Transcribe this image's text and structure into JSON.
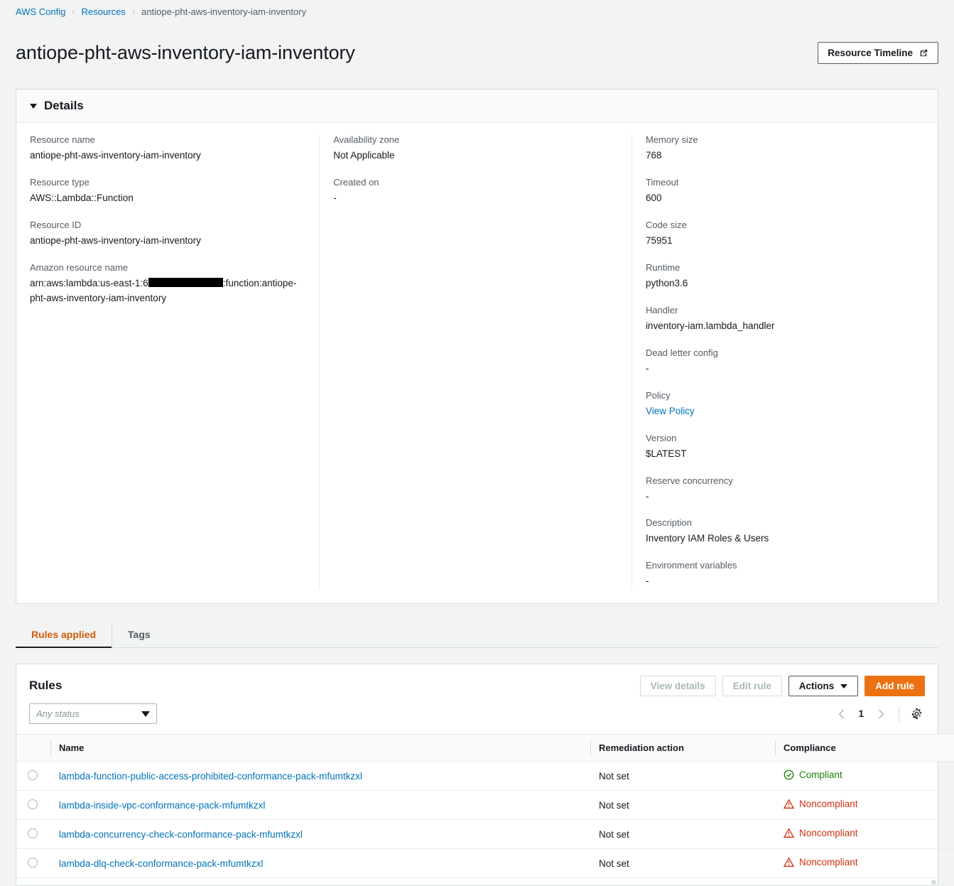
{
  "breadcrumb": {
    "items": [
      {
        "label": "AWS Config",
        "type": "link"
      },
      {
        "label": "Resources",
        "type": "link"
      },
      {
        "label": "antiope-pht-aws-inventory-iam-inventory",
        "type": "current"
      }
    ],
    "separator": "›"
  },
  "header": {
    "title": "antiope-pht-aws-inventory-iam-inventory",
    "timeline_button": "Resource Timeline"
  },
  "details": {
    "section_title": "Details",
    "column1": [
      {
        "label": "Resource name",
        "value": "antiope-pht-aws-inventory-iam-inventory"
      },
      {
        "label": "Resource type",
        "value": "AWS::Lambda::Function"
      },
      {
        "label": "Resource ID",
        "value": "antiope-pht-aws-inventory-iam-inventory"
      }
    ],
    "arn": {
      "label": "Amazon resource name",
      "prefix": "arn:aws:lambda:us-east-1:6",
      "redacted": "███████████",
      "suffix": ":function:antiope-pht-aws-inventory-iam-inventory"
    },
    "column2": [
      {
        "label": "Availability zone",
        "value": "Not Applicable"
      },
      {
        "label": "Created on",
        "value": "-"
      }
    ],
    "column3": [
      {
        "label": "Memory size",
        "value": "768"
      },
      {
        "label": "Timeout",
        "value": "600"
      },
      {
        "label": "Code size",
        "value": "75951"
      },
      {
        "label": "Runtime",
        "value": "python3.6"
      },
      {
        "label": "Handler",
        "value": "inventory-iam.lambda_handler"
      },
      {
        "label": "Dead letter config",
        "value": "-"
      }
    ],
    "policy": {
      "label": "Policy",
      "link_text": "View Policy"
    },
    "column3b": [
      {
        "label": "Version",
        "value": "$LATEST"
      },
      {
        "label": "Reserve concurrency",
        "value": "-"
      },
      {
        "label": "Description",
        "value": "Inventory IAM Roles & Users"
      },
      {
        "label": "Environment variables",
        "value": "-"
      }
    ]
  },
  "tabs": [
    {
      "label": "Rules applied",
      "active": true
    },
    {
      "label": "Tags",
      "active": false
    }
  ],
  "rules": {
    "title": "Rules",
    "buttons": {
      "view_details": "View details",
      "edit_rule": "Edit rule",
      "actions": "Actions",
      "add_rule": "Add rule"
    },
    "status_filter_placeholder": "Any status",
    "pagination": {
      "page": "1",
      "prev": "‹",
      "next": "›"
    },
    "columns": [
      "Name",
      "Remediation action",
      "Compliance"
    ],
    "rows": [
      {
        "name": "lambda-function-public-access-prohibited-conformance-pack-mfumtkzxl",
        "remediation": "Not set",
        "compliance": "Compliant",
        "compliance_state": "ok"
      },
      {
        "name": "lambda-inside-vpc-conformance-pack-mfumtkzxl",
        "remediation": "Not set",
        "compliance": "Noncompliant",
        "compliance_state": "bad"
      },
      {
        "name": "lambda-concurrency-check-conformance-pack-mfumtkzxl",
        "remediation": "Not set",
        "compliance": "Noncompliant",
        "compliance_state": "bad"
      },
      {
        "name": "lambda-dlq-check-conformance-pack-mfumtkzxl",
        "remediation": "Not set",
        "compliance": "Noncompliant",
        "compliance_state": "bad"
      }
    ]
  },
  "colors": {
    "link": "#0073bb",
    "accent_orange": "#ec7211",
    "tab_active": "#d45b07",
    "compliant_green": "#1d8102",
    "noncompliant_red": "#d13212"
  }
}
